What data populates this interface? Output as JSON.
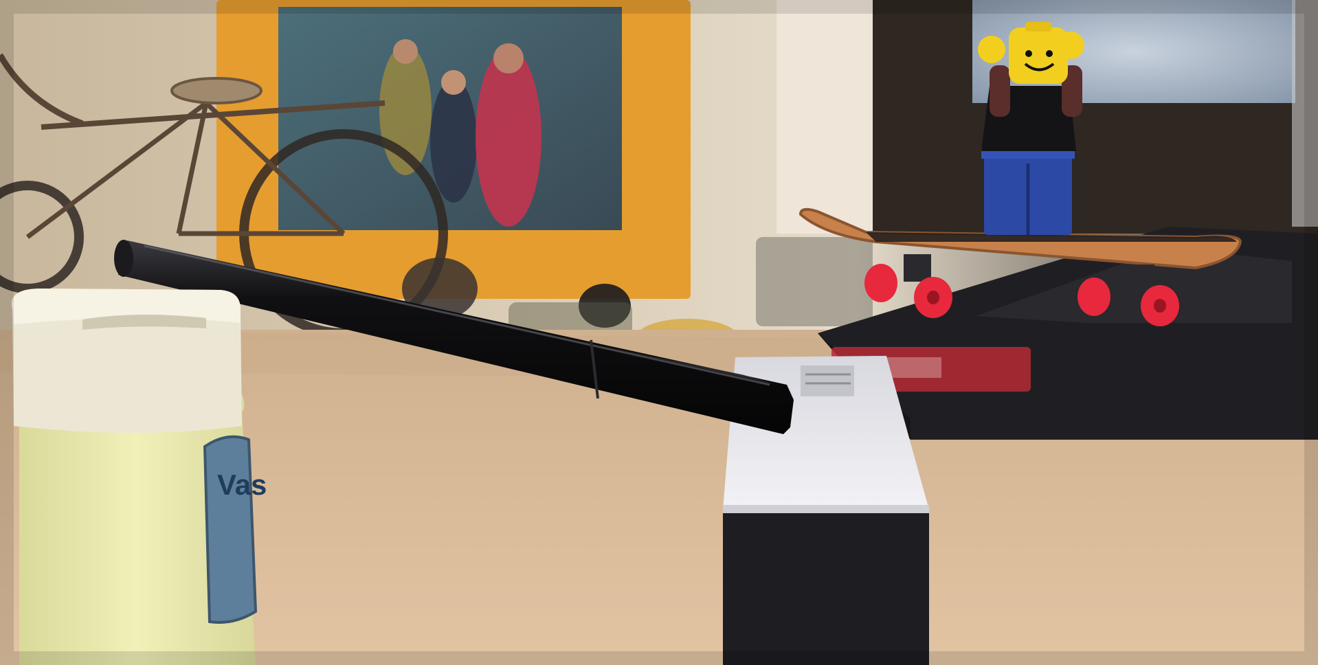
{
  "scene": {
    "description_free": true,
    "jar_label_text": "Vas",
    "colors": {
      "desk": "#d9bb9b",
      "wall": "#d7c9b2",
      "frame": "#e9a236",
      "pen": "#0e0e10",
      "box_top": "#e9e9ee",
      "box_side": "#1d1d22",
      "jar_body": "#e6e6a6",
      "jar_lid": "#ece7d5",
      "deck": "#c8814a",
      "wheels": "#e8283c",
      "minifig_head": "#f2cf1f",
      "minifig_torso": "#141416",
      "minifig_legs": "#2c49a6",
      "ramp": "#202024"
    },
    "icons": [
      "bicycle-model",
      "photo-frame",
      "pen",
      "jar",
      "box",
      "fingerboard",
      "minifigure",
      "ramp"
    ]
  }
}
